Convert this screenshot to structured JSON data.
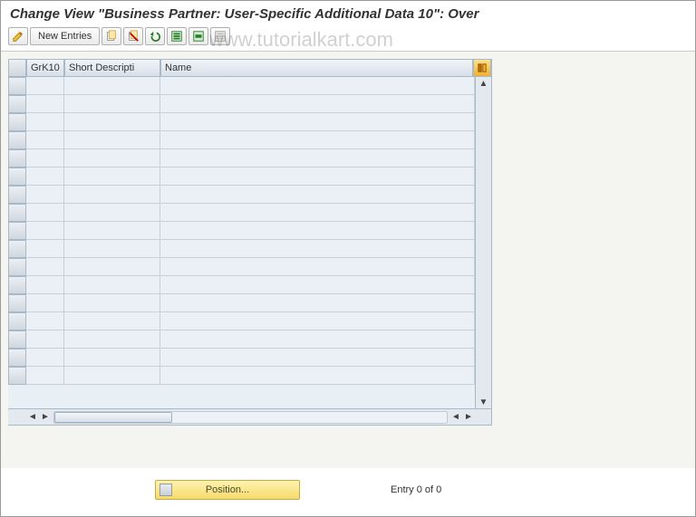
{
  "title": "Change View \"Business Partner: User-Specific Additional Data 10\": Over",
  "watermark": "www.tutorialkart.com",
  "toolbar": {
    "new_entries": "New Entries"
  },
  "columns": {
    "c1": "GrK10",
    "c2": "Short Descripti",
    "c3": "Name"
  },
  "rows": [
    {},
    {},
    {},
    {},
    {},
    {},
    {},
    {},
    {},
    {},
    {},
    {},
    {},
    {},
    {},
    {},
    {}
  ],
  "footer": {
    "position_label": "Position...",
    "entry_text": "Entry 0 of 0"
  }
}
